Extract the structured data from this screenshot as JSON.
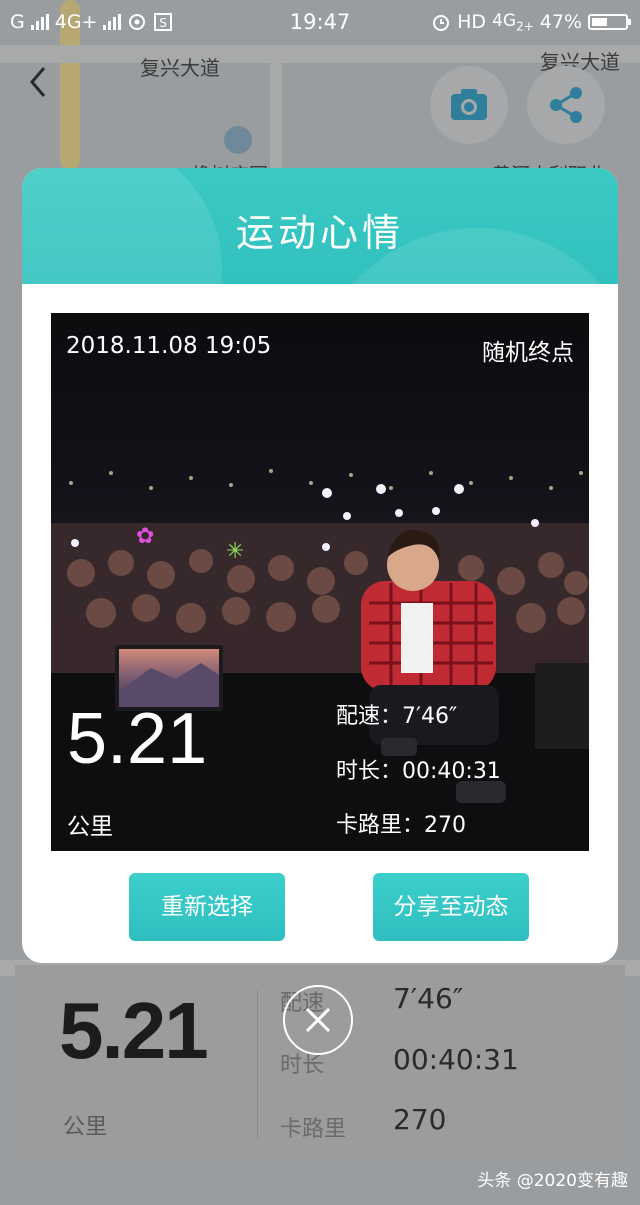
{
  "status_bar": {
    "carrier_1": "G",
    "network_2": "4G+",
    "time": "19:47",
    "hd": "HD",
    "network_3": "4G",
    "network_3_suffix": "2+",
    "battery": "47%",
    "battery_level": 0.47
  },
  "map": {
    "road_label_1": "复兴大道",
    "road_label_2": "复兴大道",
    "poi_label_1": "橡树庄园",
    "poi_label_2": "黄河水利职业"
  },
  "modal": {
    "title": "运动心情",
    "photo": {
      "datetime": "2018.11.08 19:05",
      "mode": "随机终点",
      "distance": "5.21",
      "distance_unit": "公里",
      "pace": "配速：7′46″",
      "duration": "时长：00:40:31",
      "calories": "卡路里：270"
    },
    "reselect_button": "重新选择",
    "share_button": "分享至动态"
  },
  "summary": {
    "distance": "5.21",
    "distance_unit": "公里",
    "pace_label": "配速",
    "pace_value": "7′46″",
    "duration_label": "时长",
    "duration_value": "00:40:31",
    "calories_label": "卡路里",
    "calories_value": "270"
  },
  "watermark": "头条 @2020变有趣",
  "icons": {
    "back": "chevron-left-icon",
    "camera": "camera-icon",
    "share": "share-icon",
    "close": "close-icon"
  },
  "colors": {
    "accent": "#33c3c0",
    "overlay": "#8e9294"
  }
}
